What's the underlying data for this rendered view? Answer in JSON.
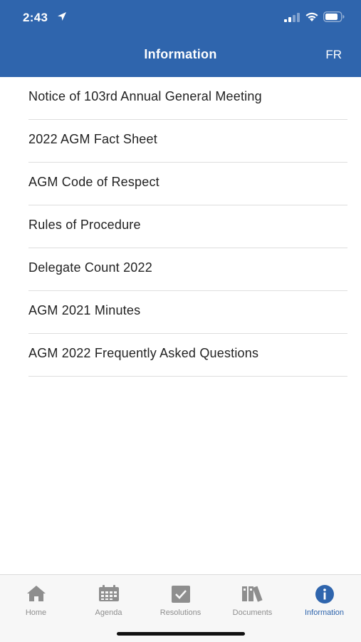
{
  "status_bar": {
    "time": "2:43"
  },
  "header": {
    "title": "Information",
    "language_toggle": "FR"
  },
  "items": [
    {
      "label": "Notice of 103rd Annual General Meeting"
    },
    {
      "label": "2022 AGM Fact Sheet"
    },
    {
      "label": "AGM Code of Respect"
    },
    {
      "label": "Rules of Procedure"
    },
    {
      "label": "Delegate Count 2022"
    },
    {
      "label": "AGM 2021 Minutes"
    },
    {
      "label": "AGM 2022 Frequently Asked Questions"
    }
  ],
  "tabs": [
    {
      "label": "Home",
      "icon": "home-icon",
      "active": false
    },
    {
      "label": "Agenda",
      "icon": "calendar-icon",
      "active": false
    },
    {
      "label": "Resolutions",
      "icon": "checkbox-icon",
      "active": false
    },
    {
      "label": "Documents",
      "icon": "binders-icon",
      "active": false
    },
    {
      "label": "Information",
      "icon": "info-icon",
      "active": true
    }
  ],
  "colors": {
    "brand": "#2f65ad",
    "inactive_tab": "#8e8e8e"
  }
}
